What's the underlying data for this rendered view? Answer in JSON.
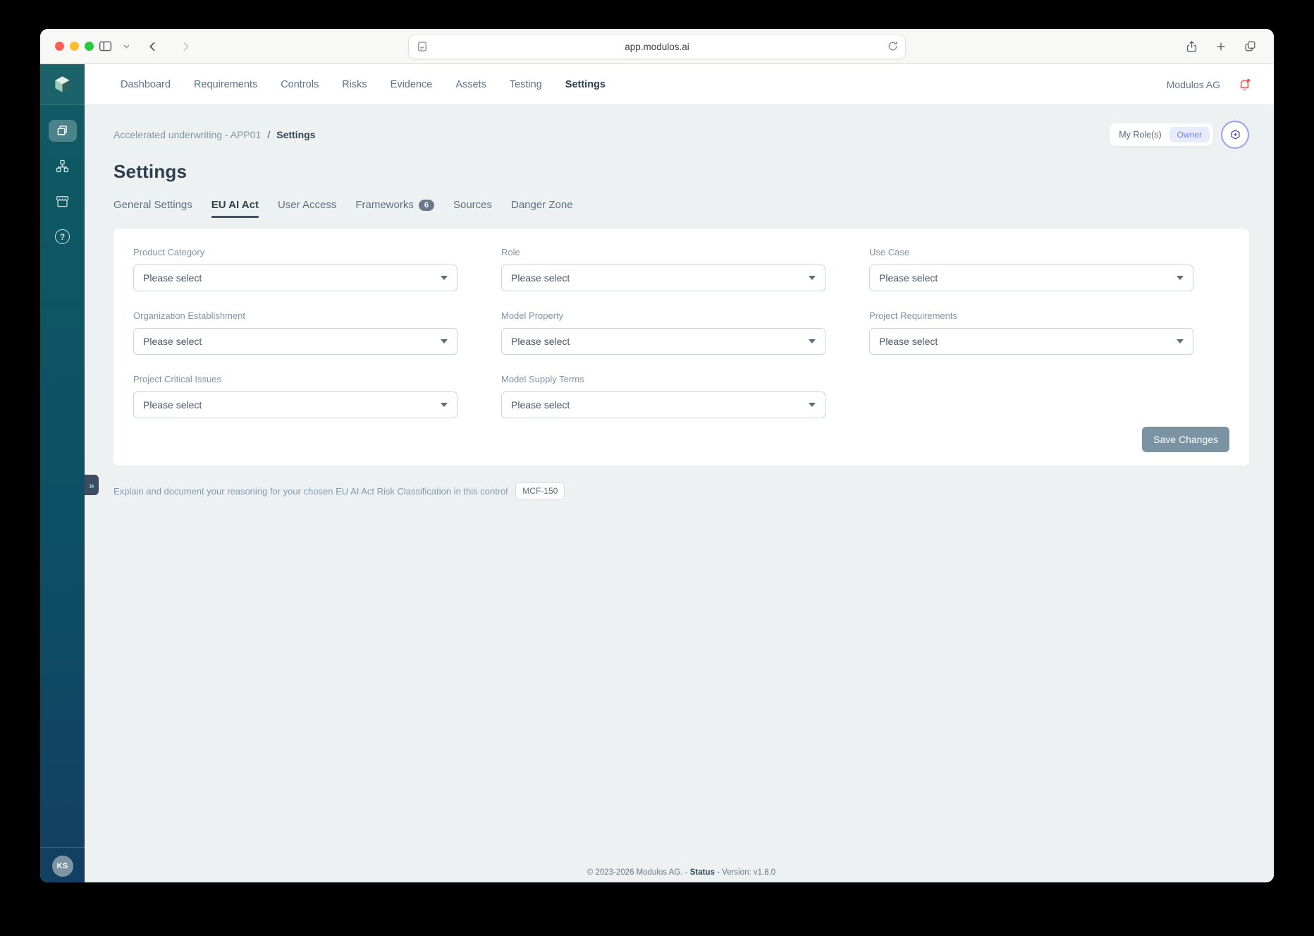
{
  "browser": {
    "url": "app.modulos.ai"
  },
  "nav": {
    "items": [
      {
        "label": "Dashboard"
      },
      {
        "label": "Requirements"
      },
      {
        "label": "Controls"
      },
      {
        "label": "Risks"
      },
      {
        "label": "Evidence"
      },
      {
        "label": "Assets"
      },
      {
        "label": "Testing"
      },
      {
        "label": "Settings",
        "active": true
      }
    ],
    "org_label": "Modulos AG"
  },
  "breadcrumb": {
    "parent": "Accelerated underwriting - APP01",
    "separator": "/",
    "current": "Settings"
  },
  "role_widget": {
    "label": "My Role(s)",
    "value": "Owner"
  },
  "page": {
    "title": "Settings"
  },
  "tabs": {
    "items": [
      {
        "label": "General Settings"
      },
      {
        "label": "EU AI Act",
        "active": true
      },
      {
        "label": "User Access"
      },
      {
        "label": "Frameworks",
        "badge": "6"
      },
      {
        "label": "Sources"
      },
      {
        "label": "Danger Zone"
      }
    ]
  },
  "form": {
    "fields": [
      {
        "label": "Product Category",
        "placeholder": "Please select"
      },
      {
        "label": "Role",
        "placeholder": "Please select"
      },
      {
        "label": "Use Case",
        "placeholder": "Please select"
      },
      {
        "label": "Organization Establishment",
        "placeholder": "Please select"
      },
      {
        "label": "Model Property",
        "placeholder": "Please select"
      },
      {
        "label": "Project Requirements",
        "placeholder": "Please select"
      },
      {
        "label": "Project Critical Issues",
        "placeholder": "Please select"
      },
      {
        "label": "Model Supply Terms",
        "placeholder": "Please select"
      }
    ],
    "save_label": "Save Changes"
  },
  "note": {
    "text": "Explain and document your reasoning for your chosen EU AI Act Risk Classification in this control",
    "control_id": "MCF-150"
  },
  "sidebar": {
    "user_initials": "KS",
    "expand_glyph": "»",
    "help_glyph": "?"
  },
  "footer": {
    "prefix": "© 2023-2026 Modulos AG. -",
    "status": "Status",
    "suffix": "- Version: v1.8.0"
  },
  "colors": {
    "sidebar_top": "#0f5b64",
    "sidebar_bottom": "#123f63",
    "main_bg": "#eef1f2",
    "notification_red": "#ee5a5a",
    "owner_badge_bg": "#e7ebfc",
    "owner_badge_text": "#7180e8",
    "assistant_ring": "#676ceb",
    "save_button": "#7b93a3",
    "active_tab": "#33424f"
  },
  "icons": {
    "toolbar": [
      "sidebar-toggle",
      "chevron-down",
      "back",
      "forward",
      "page",
      "reload",
      "share",
      "new-tab",
      "tab-overview"
    ],
    "sidebar": [
      "logo-cube",
      "projects",
      "hierarchy",
      "marketplace",
      "help"
    ],
    "other": [
      "notification-bell",
      "assistant-hexagon",
      "select-caret",
      "expand-chevrons"
    ]
  }
}
